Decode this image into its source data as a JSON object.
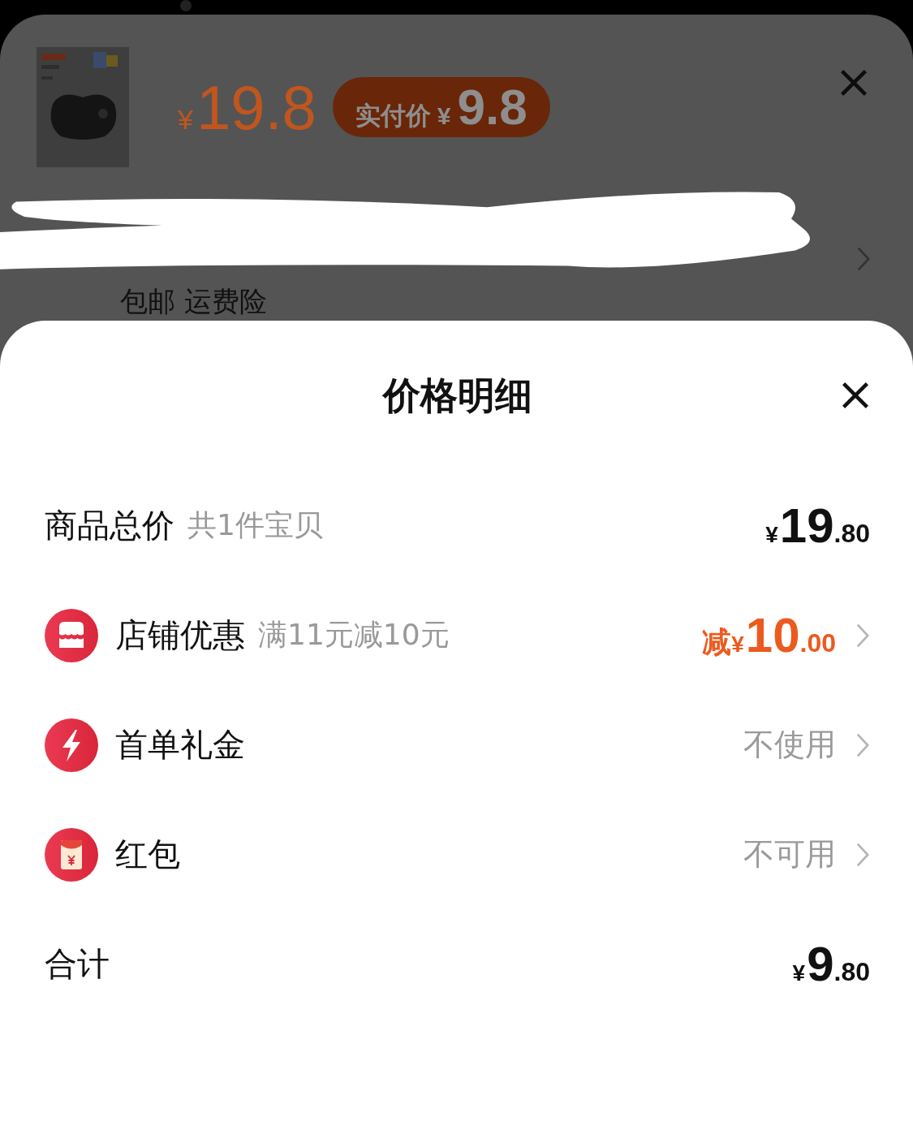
{
  "product": {
    "price": {
      "currency": "¥",
      "amount": "19.8"
    },
    "pay_badge": {
      "label": "实付价",
      "currency": "¥",
      "amount": "9.8"
    },
    "shipping": "包邮 运费险"
  },
  "sheet": {
    "title": "价格明细",
    "rows": [
      {
        "kind": "total",
        "label": "商品总价",
        "note": "共1件宝贝",
        "value": {
          "currency": "¥",
          "integer": "19",
          "decimal": ".80"
        },
        "chevron": false
      },
      {
        "kind": "store",
        "label": "店铺优惠",
        "note": "满11元减10元",
        "value": {
          "prefix": "减",
          "currency": "¥",
          "integer": "10",
          "decimal": ".00"
        },
        "chevron": true
      },
      {
        "kind": "bolt",
        "label": "首单礼金",
        "text": "不使用",
        "chevron": true
      },
      {
        "kind": "envelope",
        "label": "红包",
        "text": "不可用",
        "chevron": true
      },
      {
        "kind": "total",
        "label": "合计",
        "value": {
          "currency": "¥",
          "integer": "9",
          "decimal": ".80"
        },
        "chevron": false
      }
    ]
  }
}
